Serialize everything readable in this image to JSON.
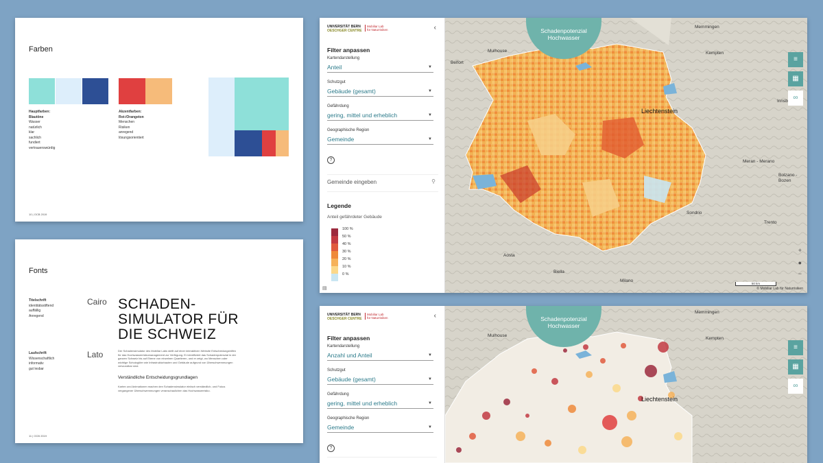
{
  "farben_slide": {
    "title": "Farben",
    "haupt_label": "Hauptfarben:",
    "haupt_sub": "Blautöne",
    "haupt_words": [
      "Wasser",
      "natürlich",
      "klar",
      "sachlich",
      "fundiert",
      "vertrauenswürdig"
    ],
    "akzent_label": "Akzentfarben:",
    "akzent_sub": "Rot-/Orangeton",
    "akzent_words": [
      "Menschen",
      "Risiken",
      "anregend",
      "lösungsorientiert"
    ],
    "footer": "10   | OCB 2019",
    "colors": {
      "turquoise": "#8ee0d9",
      "lightblue": "#ddeefb",
      "darkblue": "#2d4f95",
      "red": "#e04040",
      "orange": "#f6bb7a"
    }
  },
  "fonts_slide": {
    "title": "Fonts",
    "title_font_label": "Titelschrift",
    "title_font_words": [
      "identitätsstiftend",
      "auffällig",
      "Anregend"
    ],
    "title_font_name": "Cairo",
    "body_font_label": "Laufschrift",
    "body_font_words": [
      "Wissenschaftlich",
      "informativ",
      "gut lesbar"
    ],
    "body_font_name": "Lato",
    "headline_lines": [
      "SCHADEN-",
      "SIMULATOR FÜR",
      "DIE SCHWEIZ"
    ],
    "body_text": "Der Schadensimulator des Mobiliar Labs stellt auf einer interaktiven Website Entscheidungshilfen für das Hochwasserrisikomanagement zur Verfügung. Er identifiziert das Schadenpotenzial in der ganzen Schweiz bis auf Ebene von einzelnen Quartieren, und er zeigt, wo Menschen oder wichtige Schutzgüter wie Infrastrukturbauten und Gebäude aufgrund von Überschwemmungen verwundbar sind.",
    "subheadline": "Verständliche Entscheidungsgrundlagen",
    "body_text2": "Karten und Animationen machen den Schadensimulator einfach verständlich, und Fokus vergangener Überschwemmungen veranschaulichen das Hochwasserrisiko.",
    "footer": "11   | OCB 2019"
  },
  "map_top": {
    "logo_line1": "UNIVERSITÄT BERN",
    "logo_line2": "OESCHGER CENTRE",
    "logo_right1": "Mobiliar Lab",
    "logo_right2": "für Naturrisiken",
    "filter_title": "Filter anpassen",
    "filters": [
      {
        "label": "Kartendarstellung",
        "value": "Anteil"
      },
      {
        "label": "Schutzgut",
        "value": "Gebäude (gesamt)"
      },
      {
        "label": "Gefährdung",
        "value": "gering, mittel und erheblich"
      },
      {
        "label": "Geographische Region",
        "value": "Gemeinde"
      }
    ],
    "help_icon": "?",
    "search_placeholder": "Gemeinde eingeben",
    "legend_title": "Legende",
    "legend_subtitle": "Anteil gefährdeter Gebäude",
    "legend_ticks": [
      "100 %",
      "50 %",
      "40 %",
      "30 %",
      "20 %",
      "10 %",
      "0 %"
    ],
    "legend_colors": [
      "#9c2a3e",
      "#c23a43",
      "#e05a3e",
      "#ef8a3b",
      "#f6b25a",
      "#fbd88a",
      "#c9e6f2"
    ],
    "badge_line1": "Schadenpotenzial",
    "badge_line2": "Hochwasser",
    "places": [
      "Memmingen",
      "Kempten",
      "Mulhouse",
      "Belfort",
      "Liechtenstein",
      "Innsbruck",
      "Meran - Merano",
      "Bolzano - Bozen",
      "Sondrio",
      "Trento",
      "Aosta",
      "Biella",
      "Milano"
    ],
    "scale": "50 km",
    "credit": "© Mobiliar Lab für Naturrisiken"
  },
  "map_bottom": {
    "filters": [
      {
        "label": "Kartendarstellung",
        "value": "Anzahl und Anteil"
      },
      {
        "label": "Schutzgut",
        "value": "Gebäude (gesamt)"
      },
      {
        "label": "Gefährdung",
        "value": "gering, mittel und erheblich"
      },
      {
        "label": "Geographische Region",
        "value": "Gemeinde"
      }
    ],
    "places": [
      "Memmingen",
      "Kempten",
      "Mulhouse",
      "Liechtenstein"
    ]
  }
}
